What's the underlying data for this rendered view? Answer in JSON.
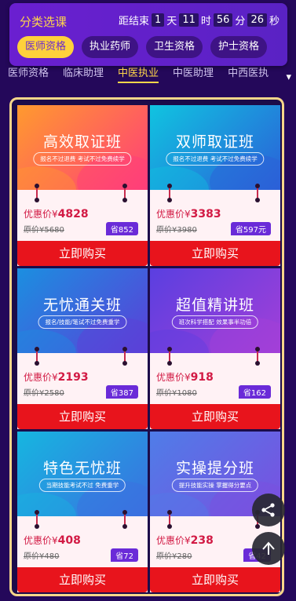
{
  "header": {
    "category_title": "分类选课",
    "countdown": {
      "prefix": "距结束",
      "days": "1",
      "days_unit": "天",
      "hours": "11",
      "hours_unit": "时",
      "minutes": "56",
      "minutes_unit": "分",
      "seconds": "26",
      "seconds_unit": "秒"
    },
    "categories": [
      "医师资格",
      "执业药师",
      "卫生资格",
      "护士资格"
    ]
  },
  "subtabs": [
    "医师资格",
    "临床助理",
    "中医执业",
    "中医助理",
    "中西医执"
  ],
  "subtab_arrow": "▾",
  "cards": [
    {
      "title": "高效取证班",
      "subtitle": "报名不过退费 考试不过免费续学",
      "price_label": "优惠价",
      "currency": "¥",
      "price": "4828",
      "original": "原价¥5680",
      "save": "省852",
      "buy": "立即购买",
      "c1": "#ff9a2e",
      "c2": "#ff3d7a"
    },
    {
      "title": "双师取证班",
      "subtitle": "报名不过退费 考试不过免费续学",
      "price_label": "优惠价",
      "currency": "¥",
      "price": "3383",
      "original": "原价¥3980",
      "save": "省597元",
      "buy": "立即购买",
      "c1": "#10c4e0",
      "c2": "#2b5fd8"
    },
    {
      "title": "无忧通关班",
      "subtitle": "报名/技能/笔试不过免费重学",
      "price_label": "优惠价",
      "currency": "¥",
      "price": "2193",
      "original": "原价¥2580",
      "save": "省387",
      "buy": "立即购买",
      "c1": "#1b8fe0",
      "c2": "#5b3fd8"
    },
    {
      "title": "超值精讲班",
      "subtitle": "班次科学搭配 效果事半功倍",
      "price_label": "优惠价",
      "currency": "¥",
      "price": "918",
      "original": "原价¥1080",
      "save": "省162",
      "buy": "立即购买",
      "c1": "#5a3fe0",
      "c2": "#a33fd8"
    },
    {
      "title": "特色无忧班",
      "subtitle": "当期技能考试不过 免费重学",
      "price_label": "优惠价",
      "currency": "¥",
      "price": "408",
      "original": "原价¥480",
      "save": "省72",
      "buy": "立即购买",
      "c1": "#16b6e0",
      "c2": "#3b6fe0"
    },
    {
      "title": "实操提分班",
      "subtitle": "提升技能实操 掌握得分要点",
      "price_label": "优惠价",
      "currency": "¥",
      "price": "238",
      "original": "原价¥280",
      "save": "省42",
      "buy": "立即购买",
      "c1": "#4f7de8",
      "c2": "#7a4fe0"
    }
  ],
  "icons": {
    "share": "share-icon",
    "back_to_top": "arrow-up-icon"
  }
}
